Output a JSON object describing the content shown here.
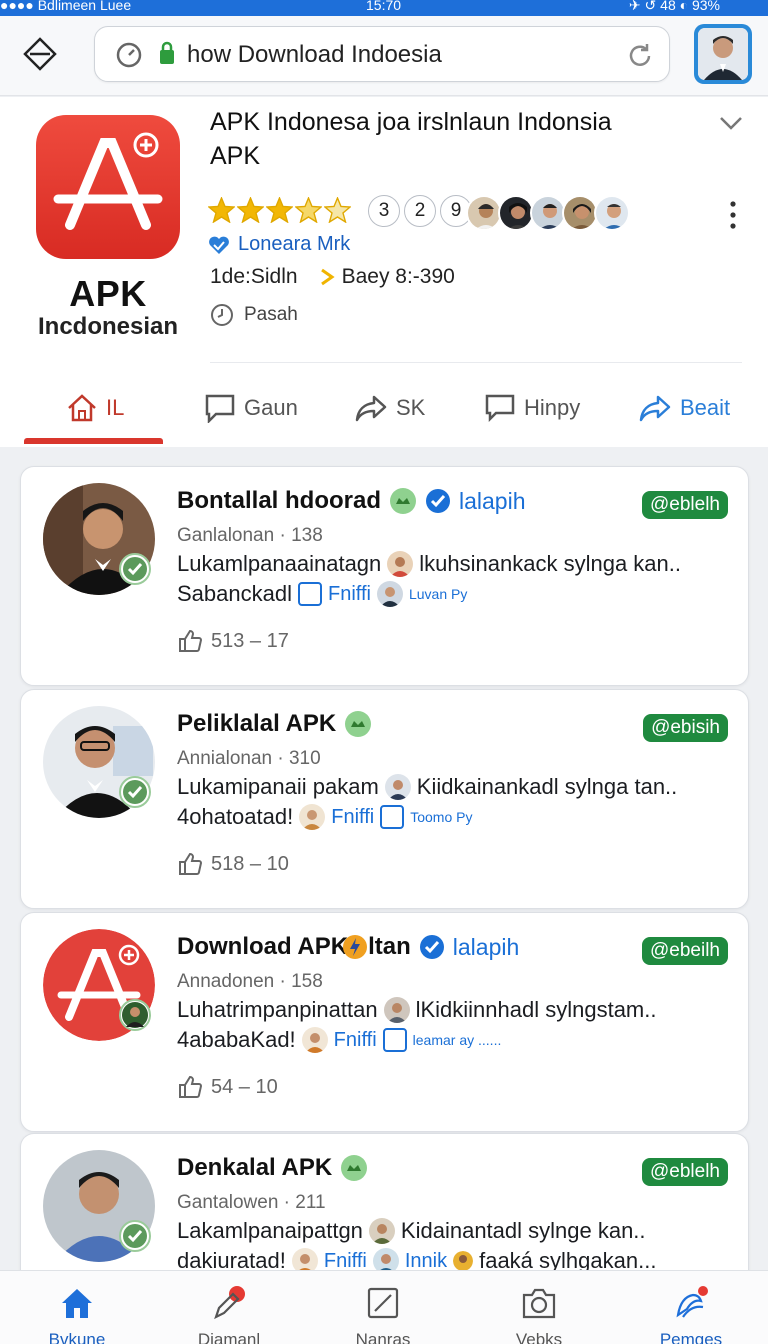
{
  "status_bar": {
    "left": "●●●● Bdlimeen  Luee",
    "time": "15:70",
    "right": "✈ ↺ 48  ◐ 93%"
  },
  "browser": {
    "url_text": "how Download Indoesia"
  },
  "app": {
    "logo_title": "APK",
    "logo_subtitle": "Incdonesian",
    "title": "APK Indonesa  joa irslnlaun Indonsia APK",
    "rating_stars": 4.5,
    "rating_max": 5,
    "pills": [
      "3",
      "2",
      "9"
    ],
    "developer": "Loneara  Mrk",
    "meta_left": "1de:Sidln",
    "meta_right": "Baey 8:-390",
    "pasah": "Pasah",
    "tabs": [
      {
        "label": "IL",
        "icon": "home-icon"
      },
      {
        "label": "Gaun",
        "icon": "chat-icon"
      },
      {
        "label": "SK",
        "icon": "share-icon"
      },
      {
        "label": "Hinpy",
        "icon": "comment-icon"
      },
      {
        "label": "Beait",
        "icon": "send-icon"
      }
    ]
  },
  "feed": [
    {
      "name": "Bontallal hdoorad",
      "handle": "lalapih",
      "badge": "@eblelh",
      "sub": "Ganlalonan · 138",
      "desc1": "Lukamlpanaainatagn",
      "desc1b": "lkuhsinankack sylnga kan..",
      "desc2": "Sabanckadl",
      "link": "Fniffi",
      "small": "Luvan Py",
      "likes": "513 – 17"
    },
    {
      "name": "Peliklalal APK",
      "handle": "",
      "badge": "@ebisih",
      "sub": "Annialonan · 310",
      "desc1": "Lukamipanaii pakam",
      "desc1b": "Kiidkainankadl sylnga tan..",
      "desc2": "4ohatoatad!",
      "link": "Fniffi",
      "small": "Toomo Py",
      "likes": "518 – 10"
    },
    {
      "name": "Download APK",
      "name2": "ltan",
      "handle": "lalapih",
      "badge": "@ebeilh",
      "sub": "Annadonen · 158",
      "desc1": "Luhatrimpanpinattan",
      "desc1b": "lKidkiinnhadl sylngstam..",
      "desc2": "4ababaKad!",
      "link": "Fniffi",
      "small": "leamar ay ......",
      "likes": "54 – 10"
    },
    {
      "name": "Denkalal APK",
      "handle": "",
      "badge": "@eblelh",
      "sub": "Gantalowen · 211",
      "desc1": "Lakamlpanaipattgn",
      "desc1b": "Kidainantadl sylnge kan..",
      "desc2": "dakiuratad!",
      "link": "Fniffi",
      "small": "Innik",
      "small2": "faaká sylhgakan...",
      "likes": ""
    }
  ],
  "bottom_nav": [
    {
      "label": "Bvkune",
      "icon": "home-icon"
    },
    {
      "label": "Diamanl",
      "icon": "pen-icon"
    },
    {
      "label": "Nanras",
      "icon": "edit-icon"
    },
    {
      "label": "Vebks",
      "icon": "camera-icon"
    },
    {
      "label": "Pemges",
      "icon": "people-icon"
    }
  ],
  "colors": {
    "accent": "#1e6fd9",
    "brand_red": "#e53a33",
    "badge_green": "#1f8a3f"
  }
}
